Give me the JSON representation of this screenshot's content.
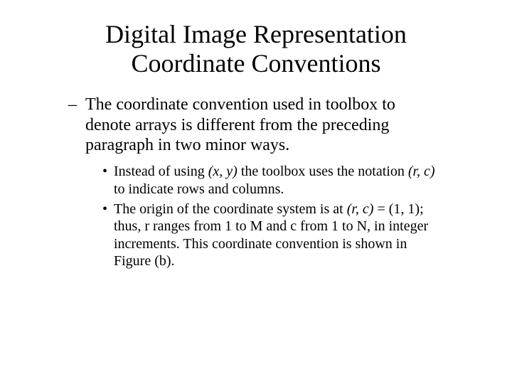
{
  "title_line1": "Digital Image Representation",
  "title_line2": "Coordinate Conventions",
  "point_main": "The coordinate convention used in toolbox to denote arrays is different from the preceding paragraph in two minor ways.",
  "sub1_a": "Instead of using ",
  "sub1_i1": "(x, y)",
  "sub1_b": " the toolbox uses the notation ",
  "sub1_i2": "(r, c)",
  "sub1_c": " to indicate rows and columns.",
  "sub2_a": "The origin of the coordinate system is at ",
  "sub2_i1": "(r, c)",
  "sub2_b": " = (1, 1); thus, r ranges from 1 to M and c from 1 to N, in integer increments. This coordinate convention is shown in Figure (b)."
}
